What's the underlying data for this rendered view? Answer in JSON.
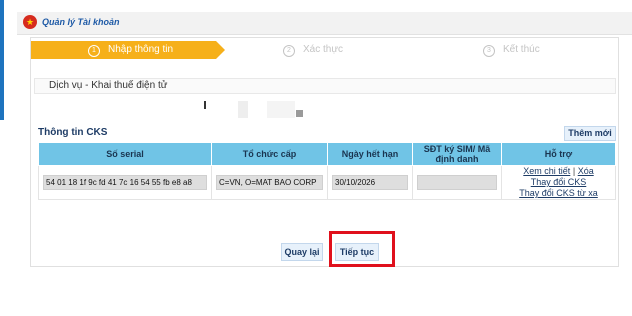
{
  "header": {
    "title": "Quản lý Tài khoản"
  },
  "steps": [
    {
      "number": "1",
      "label": "Nhập thông tin",
      "state": "active"
    },
    {
      "number": "2",
      "label": "Xác thực",
      "state": "inactive"
    },
    {
      "number": "3",
      "label": "Kết thúc",
      "state": "inactive"
    }
  ],
  "service": {
    "title": "Dịch vụ - Khai thuế điện tử"
  },
  "cks": {
    "title": "Thông tin CKS",
    "add_label": "Thêm mới",
    "columns": [
      "Số serial",
      "Tổ chức cấp",
      "Ngày hết hạn",
      "SĐT ký SIM/ Mã định danh",
      "Hỗ trợ"
    ],
    "rows": [
      {
        "serial": "54 01 18 1f 9c fd 41 7c 16 54 55 fb e8 a8",
        "issuer": "C=VN, O=MAT BAO CORP",
        "expiry": "30/10/2026",
        "sim": "",
        "links": {
          "detail": "Xem chi tiết",
          "divider": "|",
          "delete": "Xóa",
          "change": "Thay đổi CKS",
          "change_remote": "Thay đổi CKS từ xa"
        }
      }
    ]
  },
  "buttons": {
    "back": "Quay lại",
    "next": "Tiếp tục"
  },
  "colors": {
    "accent": "#f6b01a",
    "table_header": "#70c4e6",
    "link": "#1e3c66",
    "highlight": "#e0101c"
  }
}
